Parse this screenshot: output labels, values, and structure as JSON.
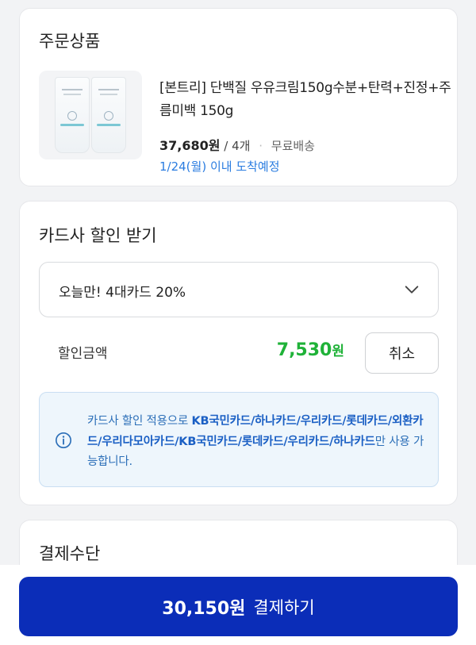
{
  "order": {
    "title": "주문상품",
    "product_name": "[본트리] 단백질 우유크림150g수분+탄력+진정+주름미백 150g",
    "price": "37,680원",
    "quantity": "/ 4개",
    "separator": "·",
    "shipping": "무료배송",
    "arrival": "1/24(월) 이내 도착예정"
  },
  "card_discount": {
    "title": "카드사 할인 받기",
    "selected_option": "오늘만! 4대카드 20%",
    "discount_label": "할인금액",
    "discount_amount": "7,530",
    "discount_unit": "원",
    "cancel_label": "취소",
    "notice_prefix": "카드사 할인 적용으로 ",
    "notice_cards": "KB국민카드/하나카드/우리카드/롯데카드/외환카드/우리다모아카드/KB국민카드/롯데카드/우리카드/하나카드",
    "notice_suffix": "만 사용 가능합니다."
  },
  "payment": {
    "title": "결제수단"
  },
  "checkout": {
    "amount": "30,150원",
    "label": "결제하기"
  },
  "colors": {
    "accent_green": "#1fb238",
    "primary_blue": "#0b2db8",
    "link_blue": "#2a7ce0"
  },
  "icons": {
    "dropdown": "chevron-down-icon",
    "info": "info-circle-icon"
  }
}
